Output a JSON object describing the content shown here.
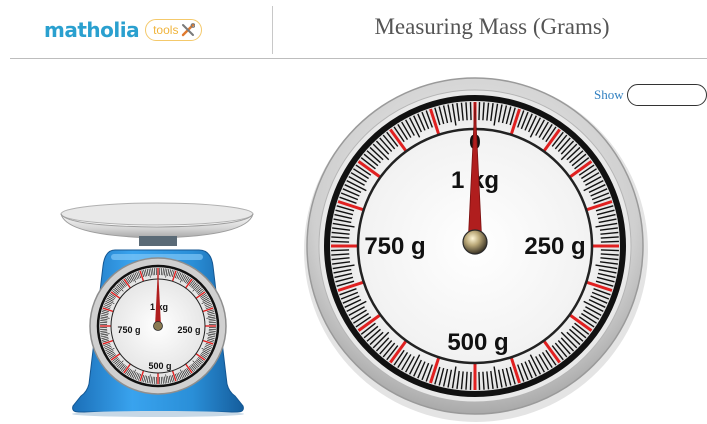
{
  "header": {
    "logo_word": "matholia",
    "logo_tools": "tools",
    "title": "Measuring Mass (Grams)"
  },
  "controls": {
    "show_label": "Show"
  },
  "scale": {
    "unit_labels": [
      "1 kg",
      "250 g",
      "500 g",
      "750 g"
    ],
    "zero_label": "0",
    "reading_fraction": 0.0,
    "colors": {
      "needle": "#b01e1e",
      "major_tick": "#e02020",
      "scale_body": "#2a8fd8",
      "bezel": "#c9c9c9"
    }
  }
}
